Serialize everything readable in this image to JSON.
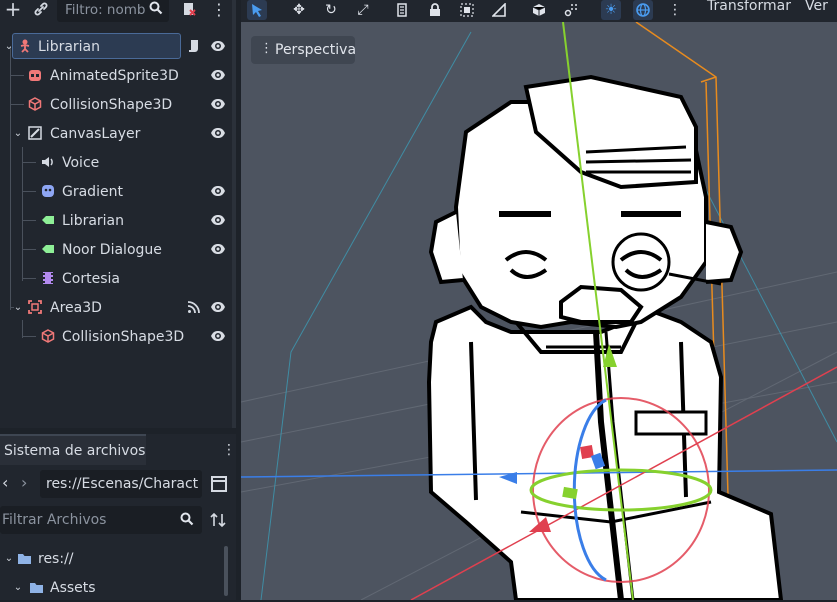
{
  "scene_dock": {
    "filter_placeholder": "Filtro: nomb",
    "tree": [
      {
        "label": "Librarian",
        "icon": "person-icon",
        "selected": true
      },
      {
        "label": "AnimatedSprite3D"
      },
      {
        "label": "CollisionShape3D"
      },
      {
        "label": "CanvasLayer"
      },
      {
        "label": "Voice"
      },
      {
        "label": "Gradient"
      },
      {
        "label": "Librarian"
      },
      {
        "label": "Noor Dialogue"
      },
      {
        "label": "Cortesia"
      },
      {
        "label": "Area3D"
      },
      {
        "label": "CollisionShape3D"
      }
    ]
  },
  "filesystem_dock": {
    "tab_label": "Sistema de archivos",
    "path": "res://Escenas/Charact",
    "filter_placeholder": "Filtrar Archivos",
    "tree": [
      {
        "label": "res://"
      },
      {
        "label": "Assets"
      }
    ]
  },
  "viewport_toolbar": {
    "transform_label": "Transformar",
    "view_label": "Ver"
  },
  "viewport": {
    "perspective_label": "Perspectiva"
  },
  "colors": {
    "accent": "#4a80d0",
    "x_axis": "#e0404f",
    "y_axis": "#86d12e",
    "z_axis": "#3a7ee8",
    "orange": "#e88b1e"
  }
}
